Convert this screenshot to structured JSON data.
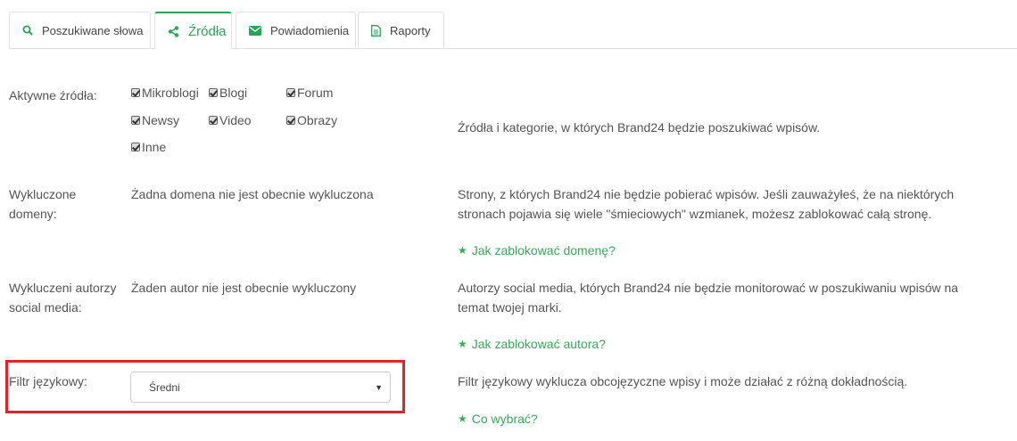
{
  "tabs": [
    {
      "label": "Poszukiwane słowa",
      "icon": "search-icon"
    },
    {
      "label": "Źródła",
      "icon": "share-icon"
    },
    {
      "label": "Powiadomienia",
      "icon": "envelope-icon"
    },
    {
      "label": "Raporty",
      "icon": "document-icon"
    }
  ],
  "active_tab": "Źródła",
  "accent_color": "#2aa35a",
  "highlight_color": "#e32229",
  "sources": {
    "label": "Aktywne źródła:",
    "options": [
      {
        "label": "Mikroblogi",
        "checked": true
      },
      {
        "label": "Blogi",
        "checked": true
      },
      {
        "label": "Forum",
        "checked": true
      },
      {
        "label": "Newsy",
        "checked": true
      },
      {
        "label": "Video",
        "checked": true
      },
      {
        "label": "Obrazy",
        "checked": true
      },
      {
        "label": "Inne",
        "checked": true
      }
    ],
    "description": "Źródła i kategorie, w których Brand24 będzie poszukiwać wpisów."
  },
  "domains": {
    "label_line1": "Wykluczone",
    "label_line2": "domeny:",
    "value": "Żadna domena nie jest obecnie wykluczona",
    "description_line1": "Strony, z których Brand24 nie będzie pobierać wpisów. Jeśli zauważyłeś, że na niektórych",
    "description_line2": "stronach pojawia się wiele \"śmieciowych\" wzmianek, możesz zablokować całą stronę.",
    "help_link": "Jak zablokować domenę?"
  },
  "authors": {
    "label_line1": "Wykluczeni autorzy",
    "label_line2": "social media:",
    "value": "Żaden autor nie jest obecnie wykluczony",
    "description_line1": "Autorzy social media, których Brand24 nie będzie monitorować w poszukiwaniu wpisów na",
    "description_line2": "temat twojej marki.",
    "help_link": "Jak zablokować autora?"
  },
  "language": {
    "label": "Filtr językowy:",
    "selected": "Średni",
    "description": "Filtr językowy wyklucza obcojęzyczne wpisy i może działać z różną dokładnością.",
    "help_link": "Co wybrać?"
  }
}
